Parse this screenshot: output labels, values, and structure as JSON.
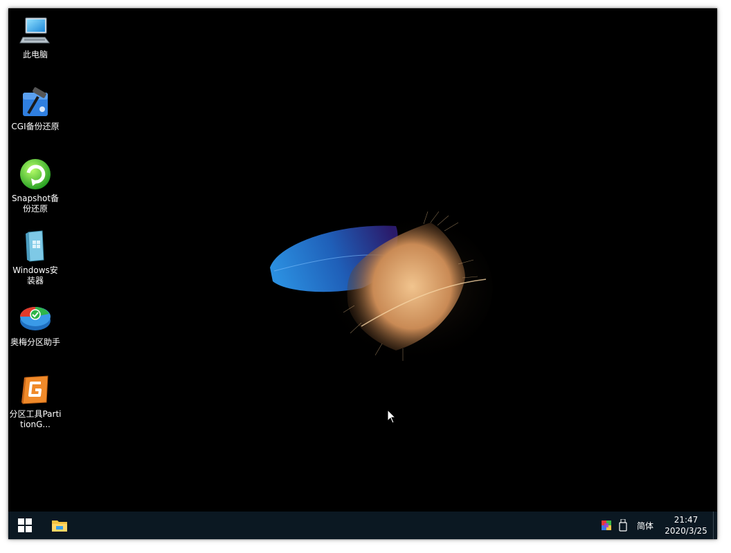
{
  "desktop": {
    "icons": [
      {
        "label": "此电脑",
        "icon": "computer-icon"
      },
      {
        "label": "CGI备份还原",
        "icon": "cgi-backup-icon"
      },
      {
        "label": "Snapshot备份还原",
        "icon": "snapshot-backup-icon"
      },
      {
        "label": "Windows安装器",
        "icon": "windows-installer-icon"
      },
      {
        "label": "奥梅分区助手",
        "icon": "aomei-partition-icon"
      },
      {
        "label": "分区工具PartitionG...",
        "icon": "partitionguru-icon"
      }
    ]
  },
  "taskbar": {
    "start_icon": "windows-logo-icon",
    "pinned": [
      {
        "icon": "file-explorer-icon"
      }
    ],
    "tray": {
      "ime_label": "简体",
      "time": "21:47",
      "date": "2020/3/25"
    }
  },
  "colors": {
    "taskbar_bg": "#0b1822",
    "desktop_bg": "#000000"
  }
}
